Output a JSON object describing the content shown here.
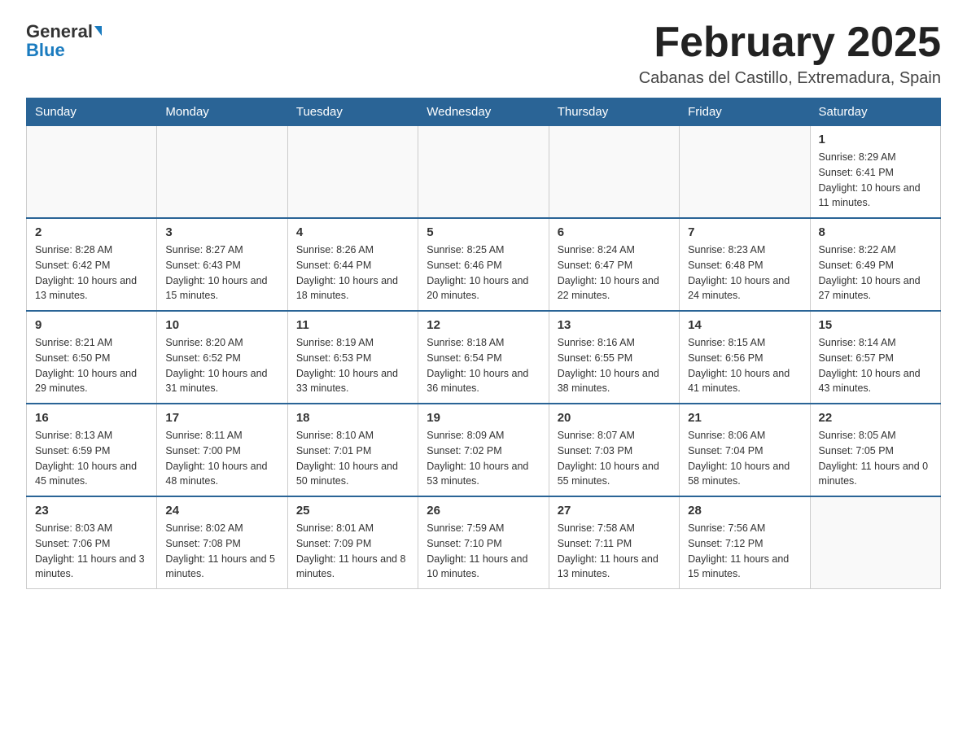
{
  "logo": {
    "general": "General",
    "blue": "Blue"
  },
  "header": {
    "title": "February 2025",
    "subtitle": "Cabanas del Castillo, Extremadura, Spain"
  },
  "weekdays": [
    "Sunday",
    "Monday",
    "Tuesday",
    "Wednesday",
    "Thursday",
    "Friday",
    "Saturday"
  ],
  "weeks": [
    [
      {
        "day": "",
        "info": ""
      },
      {
        "day": "",
        "info": ""
      },
      {
        "day": "",
        "info": ""
      },
      {
        "day": "",
        "info": ""
      },
      {
        "day": "",
        "info": ""
      },
      {
        "day": "",
        "info": ""
      },
      {
        "day": "1",
        "info": "Sunrise: 8:29 AM\nSunset: 6:41 PM\nDaylight: 10 hours and 11 minutes."
      }
    ],
    [
      {
        "day": "2",
        "info": "Sunrise: 8:28 AM\nSunset: 6:42 PM\nDaylight: 10 hours and 13 minutes."
      },
      {
        "day": "3",
        "info": "Sunrise: 8:27 AM\nSunset: 6:43 PM\nDaylight: 10 hours and 15 minutes."
      },
      {
        "day": "4",
        "info": "Sunrise: 8:26 AM\nSunset: 6:44 PM\nDaylight: 10 hours and 18 minutes."
      },
      {
        "day": "5",
        "info": "Sunrise: 8:25 AM\nSunset: 6:46 PM\nDaylight: 10 hours and 20 minutes."
      },
      {
        "day": "6",
        "info": "Sunrise: 8:24 AM\nSunset: 6:47 PM\nDaylight: 10 hours and 22 minutes."
      },
      {
        "day": "7",
        "info": "Sunrise: 8:23 AM\nSunset: 6:48 PM\nDaylight: 10 hours and 24 minutes."
      },
      {
        "day": "8",
        "info": "Sunrise: 8:22 AM\nSunset: 6:49 PM\nDaylight: 10 hours and 27 minutes."
      }
    ],
    [
      {
        "day": "9",
        "info": "Sunrise: 8:21 AM\nSunset: 6:50 PM\nDaylight: 10 hours and 29 minutes."
      },
      {
        "day": "10",
        "info": "Sunrise: 8:20 AM\nSunset: 6:52 PM\nDaylight: 10 hours and 31 minutes."
      },
      {
        "day": "11",
        "info": "Sunrise: 8:19 AM\nSunset: 6:53 PM\nDaylight: 10 hours and 33 minutes."
      },
      {
        "day": "12",
        "info": "Sunrise: 8:18 AM\nSunset: 6:54 PM\nDaylight: 10 hours and 36 minutes."
      },
      {
        "day": "13",
        "info": "Sunrise: 8:16 AM\nSunset: 6:55 PM\nDaylight: 10 hours and 38 minutes."
      },
      {
        "day": "14",
        "info": "Sunrise: 8:15 AM\nSunset: 6:56 PM\nDaylight: 10 hours and 41 minutes."
      },
      {
        "day": "15",
        "info": "Sunrise: 8:14 AM\nSunset: 6:57 PM\nDaylight: 10 hours and 43 minutes."
      }
    ],
    [
      {
        "day": "16",
        "info": "Sunrise: 8:13 AM\nSunset: 6:59 PM\nDaylight: 10 hours and 45 minutes."
      },
      {
        "day": "17",
        "info": "Sunrise: 8:11 AM\nSunset: 7:00 PM\nDaylight: 10 hours and 48 minutes."
      },
      {
        "day": "18",
        "info": "Sunrise: 8:10 AM\nSunset: 7:01 PM\nDaylight: 10 hours and 50 minutes."
      },
      {
        "day": "19",
        "info": "Sunrise: 8:09 AM\nSunset: 7:02 PM\nDaylight: 10 hours and 53 minutes."
      },
      {
        "day": "20",
        "info": "Sunrise: 8:07 AM\nSunset: 7:03 PM\nDaylight: 10 hours and 55 minutes."
      },
      {
        "day": "21",
        "info": "Sunrise: 8:06 AM\nSunset: 7:04 PM\nDaylight: 10 hours and 58 minutes."
      },
      {
        "day": "22",
        "info": "Sunrise: 8:05 AM\nSunset: 7:05 PM\nDaylight: 11 hours and 0 minutes."
      }
    ],
    [
      {
        "day": "23",
        "info": "Sunrise: 8:03 AM\nSunset: 7:06 PM\nDaylight: 11 hours and 3 minutes."
      },
      {
        "day": "24",
        "info": "Sunrise: 8:02 AM\nSunset: 7:08 PM\nDaylight: 11 hours and 5 minutes."
      },
      {
        "day": "25",
        "info": "Sunrise: 8:01 AM\nSunset: 7:09 PM\nDaylight: 11 hours and 8 minutes."
      },
      {
        "day": "26",
        "info": "Sunrise: 7:59 AM\nSunset: 7:10 PM\nDaylight: 11 hours and 10 minutes."
      },
      {
        "day": "27",
        "info": "Sunrise: 7:58 AM\nSunset: 7:11 PM\nDaylight: 11 hours and 13 minutes."
      },
      {
        "day": "28",
        "info": "Sunrise: 7:56 AM\nSunset: 7:12 PM\nDaylight: 11 hours and 15 minutes."
      },
      {
        "day": "",
        "info": ""
      }
    ]
  ]
}
